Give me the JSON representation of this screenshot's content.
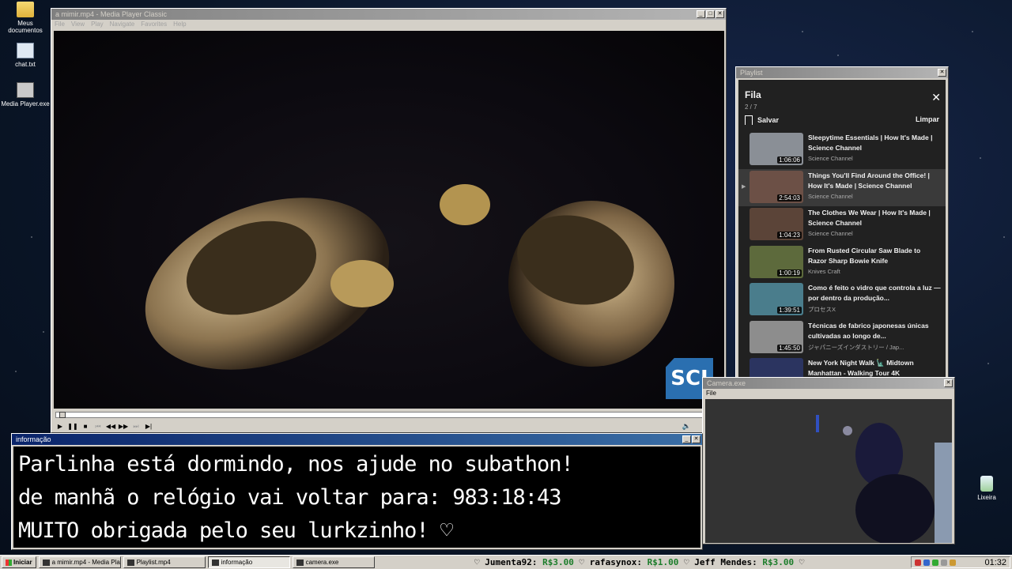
{
  "desktop": {
    "icons": [
      {
        "label": "Meus documentos",
        "icon": "folder-icon"
      },
      {
        "label": "chat.txt",
        "icon": "text-file-icon"
      },
      {
        "label": "Media Player.exe",
        "icon": "exe-icon"
      },
      {
        "label": "Lixeira",
        "icon": "recycle-bin-icon"
      }
    ]
  },
  "player": {
    "title": "a mimir.mp4 - Media Player Classic",
    "menu": [
      "File",
      "View",
      "Play",
      "Navigate",
      "Favorites",
      "Help"
    ],
    "watermark": "SCI",
    "progress": 0.005
  },
  "playlist": {
    "window_title": "Playlist",
    "heading": "Fila",
    "count": "2 / 7",
    "save_label": "Salvar",
    "clear_label": "Limpar",
    "items": [
      {
        "title": "Sleepytime Essentials | How It's Made | Science Channel",
        "channel": "Science Channel",
        "duration": "1:06:06",
        "active": false,
        "thumb_color": "#8a8f96"
      },
      {
        "title": "Things You'll Find Around the Office! | How It's Made | Science Channel",
        "channel": "Science Channel",
        "duration": "2:54:03",
        "active": true,
        "thumb_color": "#6c5046"
      },
      {
        "title": "The Clothes We Wear | How It's Made | Science Channel",
        "channel": "Science Channel",
        "duration": "1:04:23",
        "active": false,
        "thumb_color": "#5b4438"
      },
      {
        "title": "From Rusted Circular Saw Blade to Razor Sharp Bowie Knife",
        "channel": "Knives Craft",
        "duration": "1:00:19",
        "active": false,
        "thumb_color": "#5d6a3c"
      },
      {
        "title": "Como é feito o vidro que controla a luz — por dentro da produção...",
        "channel": "プロセスX",
        "duration": "1:39:51",
        "active": false,
        "thumb_color": "#4a7d8c"
      },
      {
        "title": "Técnicas de fabrico japonesas únicas cultivadas ao longo de...",
        "channel": "ジャパニーズインダストリー / Jap...",
        "duration": "1:45:50",
        "active": false,
        "thumb_color": "#8d8d8d"
      },
      {
        "title": "New York Night Walk 🗽 Midtown Manhattan - Walking Tour 4K",
        "channel": "",
        "duration": "",
        "active": false,
        "thumb_color": "#2b3460"
      }
    ]
  },
  "camera": {
    "title": "Camera.exe",
    "menu": "File"
  },
  "info": {
    "title": "informação",
    "lines": [
      "Parlinha está dormindo, nos ajude no subathon!",
      "de manhã o relógio vai voltar para:  983:18:43",
      "MUITO obrigada pelo seu lurkzinho! ♡"
    ]
  },
  "taskbar": {
    "start_label": "Iniciar",
    "tasks": [
      {
        "label": "a mimir.mp4 - Media Playe...",
        "active": false
      },
      {
        "label": "Playlist.mp4",
        "active": false
      },
      {
        "label": "informação",
        "active": true
      },
      {
        "label": "camera.exe",
        "active": false
      }
    ],
    "ticker": [
      {
        "name": "Jumenta92:",
        "amount": "R$3.00"
      },
      {
        "name": "rafasynox:",
        "amount": "R$1.00"
      },
      {
        "name": "Jeff Mendes:",
        "amount": "R$3.00"
      }
    ],
    "clock": "01:32"
  }
}
